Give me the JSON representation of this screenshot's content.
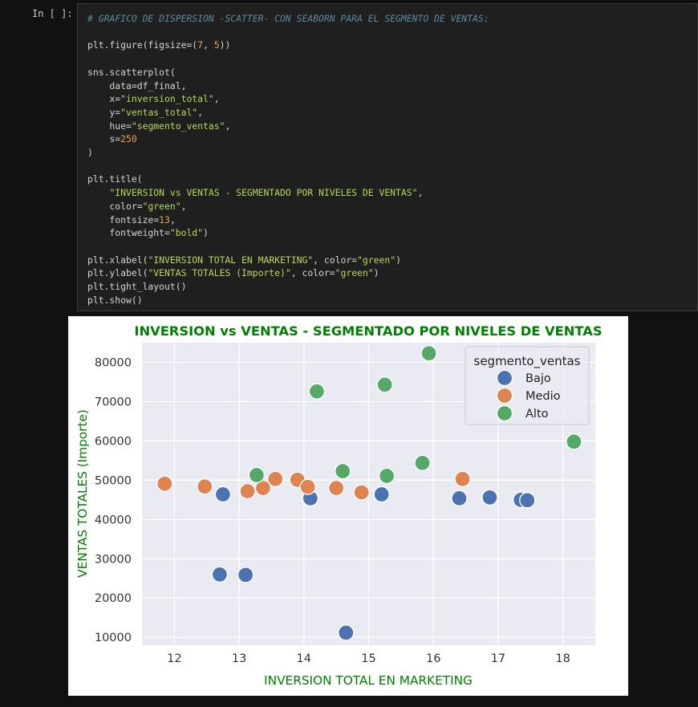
{
  "cell": {
    "prompt": "In [ ]:",
    "code_lines": [
      [
        {
          "t": "# GRAFICO DE DISPERSION -SCATTER- CON SEABORN PARA EL SEGMENTO DE VENTAS:",
          "c": "cm"
        }
      ],
      [],
      [
        {
          "t": "plt.figure(figsize=("
        },
        {
          "t": "7",
          "c": "nm"
        },
        {
          "t": ", "
        },
        {
          "t": "5",
          "c": "nm"
        },
        {
          "t": "))"
        }
      ],
      [],
      [
        {
          "t": "sns.scatterplot("
        }
      ],
      [
        {
          "t": "    data=df_final,"
        }
      ],
      [
        {
          "t": "    x="
        },
        {
          "t": "\"inversion_total\"",
          "c": "st"
        },
        {
          "t": ","
        }
      ],
      [
        {
          "t": "    y="
        },
        {
          "t": "\"ventas_total\"",
          "c": "st"
        },
        {
          "t": ","
        }
      ],
      [
        {
          "t": "    hue="
        },
        {
          "t": "\"segmento_ventas\"",
          "c": "st"
        },
        {
          "t": ","
        }
      ],
      [
        {
          "t": "    s="
        },
        {
          "t": "250",
          "c": "nm"
        }
      ],
      [
        {
          "t": ")"
        }
      ],
      [],
      [
        {
          "t": "plt.title("
        }
      ],
      [
        {
          "t": "    "
        },
        {
          "t": "\"INVERSION vs VENTAS - SEGMENTADO POR NIVELES DE VENTAS\"",
          "c": "st"
        },
        {
          "t": ","
        }
      ],
      [
        {
          "t": "    color="
        },
        {
          "t": "\"green\"",
          "c": "st"
        },
        {
          "t": ","
        }
      ],
      [
        {
          "t": "    fontsize="
        },
        {
          "t": "13",
          "c": "nm"
        },
        {
          "t": ","
        }
      ],
      [
        {
          "t": "    fontweight="
        },
        {
          "t": "\"bold\"",
          "c": "st"
        },
        {
          "t": ")"
        }
      ],
      [],
      [
        {
          "t": "plt.xlabel("
        },
        {
          "t": "\"INVERSION TOTAL EN MARKETING\"",
          "c": "st"
        },
        {
          "t": ", color="
        },
        {
          "t": "\"green\"",
          "c": "st"
        },
        {
          "t": ")"
        }
      ],
      [
        {
          "t": "plt.ylabel("
        },
        {
          "t": "\"VENTAS TOTALES (Importe)\"",
          "c": "st"
        },
        {
          "t": ", color="
        },
        {
          "t": "\"green\"",
          "c": "st"
        },
        {
          "t": ")"
        }
      ],
      [
        {
          "t": "plt.tight_layout()"
        }
      ],
      [
        {
          "t": "plt.show()"
        }
      ]
    ]
  },
  "chart_data": {
    "type": "scatter",
    "title": "INVERSION vs VENTAS - SEGMENTADO POR NIVELES DE VENTAS",
    "xlabel": "INVERSION TOTAL EN MARKETING",
    "ylabel": "VENTAS TOTALES (Importe)",
    "xlim": [
      11.5,
      18.5
    ],
    "ylim": [
      8000,
      85000
    ],
    "xticks": [
      12,
      13,
      14,
      15,
      16,
      17,
      18
    ],
    "yticks": [
      10000,
      20000,
      30000,
      40000,
      50000,
      60000,
      70000,
      80000
    ],
    "grid": true,
    "legend": {
      "title": "segmento_ventas",
      "position": "top-right"
    },
    "series": [
      {
        "name": "Bajo",
        "color": "#4c72b0",
        "points": [
          [
            12.75,
            46400
          ],
          [
            12.7,
            26000
          ],
          [
            13.1,
            25900
          ],
          [
            14.1,
            45400
          ],
          [
            14.65,
            11200
          ],
          [
            15.2,
            46400
          ],
          [
            16.4,
            45400
          ],
          [
            16.87,
            45600
          ],
          [
            17.35,
            45000
          ],
          [
            17.45,
            44900
          ]
        ]
      },
      {
        "name": "Medio",
        "color": "#dd8452",
        "points": [
          [
            11.85,
            49100
          ],
          [
            12.47,
            48400
          ],
          [
            13.13,
            47200
          ],
          [
            13.37,
            48000
          ],
          [
            13.56,
            50300
          ],
          [
            13.9,
            50100
          ],
          [
            14.06,
            48300
          ],
          [
            14.5,
            48000
          ],
          [
            14.89,
            46900
          ],
          [
            16.45,
            50300
          ]
        ]
      },
      {
        "name": "Alto",
        "color": "#55a868",
        "points": [
          [
            13.27,
            51300
          ],
          [
            14.2,
            72600
          ],
          [
            14.6,
            52300
          ],
          [
            15.25,
            74300
          ],
          [
            15.28,
            51100
          ],
          [
            15.83,
            54400
          ],
          [
            15.93,
            82300
          ],
          [
            18.17,
            59800
          ]
        ]
      }
    ]
  }
}
